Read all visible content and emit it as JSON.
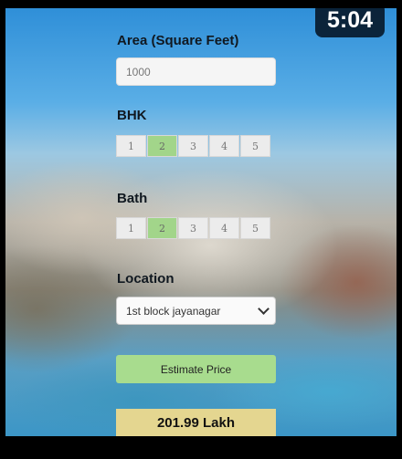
{
  "video": {
    "time": "5:04"
  },
  "form": {
    "area": {
      "label": "Area (Square Feet)",
      "value": "1000"
    },
    "bhk": {
      "label": "BHK",
      "options": [
        "1",
        "2",
        "3",
        "4",
        "5"
      ],
      "selected": "2"
    },
    "bath": {
      "label": "Bath",
      "options": [
        "1",
        "2",
        "3",
        "4",
        "5"
      ],
      "selected": "2"
    },
    "location": {
      "label": "Location",
      "selected": "1st block jayanagar"
    },
    "estimate_button": "Estimate Price",
    "result": "201.99 Lakh"
  },
  "colors": {
    "selected_option": "#a2d58a",
    "button": "#a8dc8e",
    "result_bg": "#e4d690"
  }
}
